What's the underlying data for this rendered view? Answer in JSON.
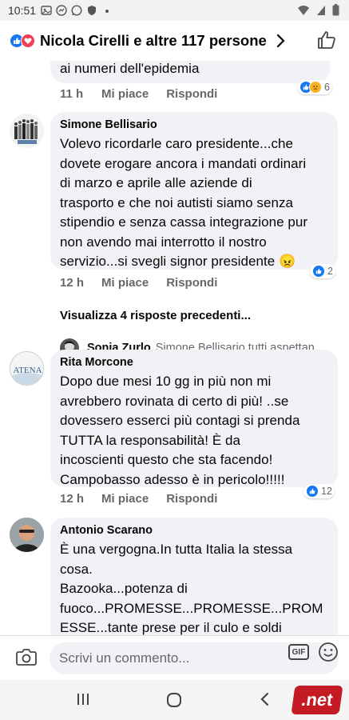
{
  "status_bar": {
    "time": "10:51"
  },
  "header": {
    "title": "Nicola Cirelli e altre 117 persone"
  },
  "previous_comment": {
    "text_tail": "ai numeri dell'epidemia",
    "time": "11 h",
    "like_label": "Mi piace",
    "reply_label": "Rispondi",
    "reaction_count": "6"
  },
  "comments": [
    {
      "author": "Simone Bellisario",
      "text": "Volevo ricordarle caro presidente...che\ndovete erogare ancora i mandati ordinari\ndi marzo e aprile alle aziende di\ntrasporto e che noi autisti siamo senza\nstipendio e senza cassa integrazione pur\nnon avendo mai interrotto il nostro\nservizio...si svegli signor presidente 😠",
      "time": "12 h",
      "like_label": "Mi piace",
      "reply_label": "Rispondi",
      "reaction_count": "2"
    },
    {
      "author": "Rita Morcone",
      "avatar_text": "ATENA",
      "text": "Dopo due mesi 10 gg in più non mi\navrebbero rovinata di certo di  più! ..se\ndovessero esserci più  contagi si prenda\nTUTTA la responsabilità! È  da\nincoscienti questo che sta facendo!\nCampobasso adesso è in pericolo!!!!!",
      "time": "12 h",
      "like_label": "Mi piace",
      "reply_label": "Rispondi",
      "reaction_count": "12"
    },
    {
      "author": "Antonio Scarano",
      "text": "È una vergogna.In tutta Italia la stessa\ncosa.\nBazooka...potenza di\nfuoco...PROMESSE...PROMESSE...PROM\nESSE...tante prese per il culo e soldi"
    }
  ],
  "view_more_replies": "Visualizza 4 risposte precedenti...",
  "reply_preview": {
    "author": "Sonia Zurlo",
    "text": "Simone Bellisario tutti aspettan..."
  },
  "composer": {
    "placeholder": "Scrivi un commento...",
    "gif_label": "GIF"
  },
  "watermark": ".net",
  "colors": {
    "like_blue": "#1877f2",
    "love_red": "#f33e58",
    "sad_yellow": "#f7b125",
    "bubble_gray": "#f0f2f5",
    "meta_gray": "#65676b"
  }
}
